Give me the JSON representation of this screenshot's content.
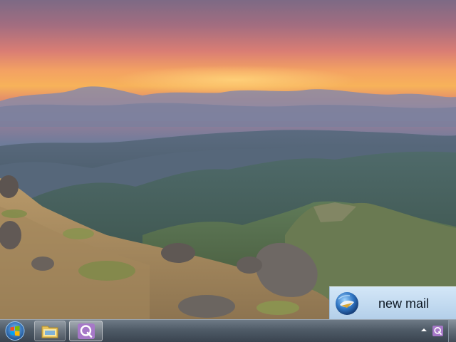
{
  "desktop": {
    "wallpaper_icon": "mountain-sunset-landscape"
  },
  "notification": {
    "icon": "mail-client-icon",
    "text": "new mail"
  },
  "taskbar": {
    "start_icon": "windows-orb-icon",
    "pinned": [
      {
        "icon": "folder-explorer-icon"
      },
      {
        "icon": "q-app-icon",
        "active": true
      }
    ],
    "tray": [
      {
        "icon": "chevron-up-icon"
      },
      {
        "icon": "q-app-tray-icon"
      }
    ]
  },
  "colors": {
    "taskbar": "#4f5b67",
    "notification_bg": "#c2daf0",
    "q_app": "#a678c8",
    "sky_top": "#8a6a86",
    "sunset": "#f6a35a"
  }
}
